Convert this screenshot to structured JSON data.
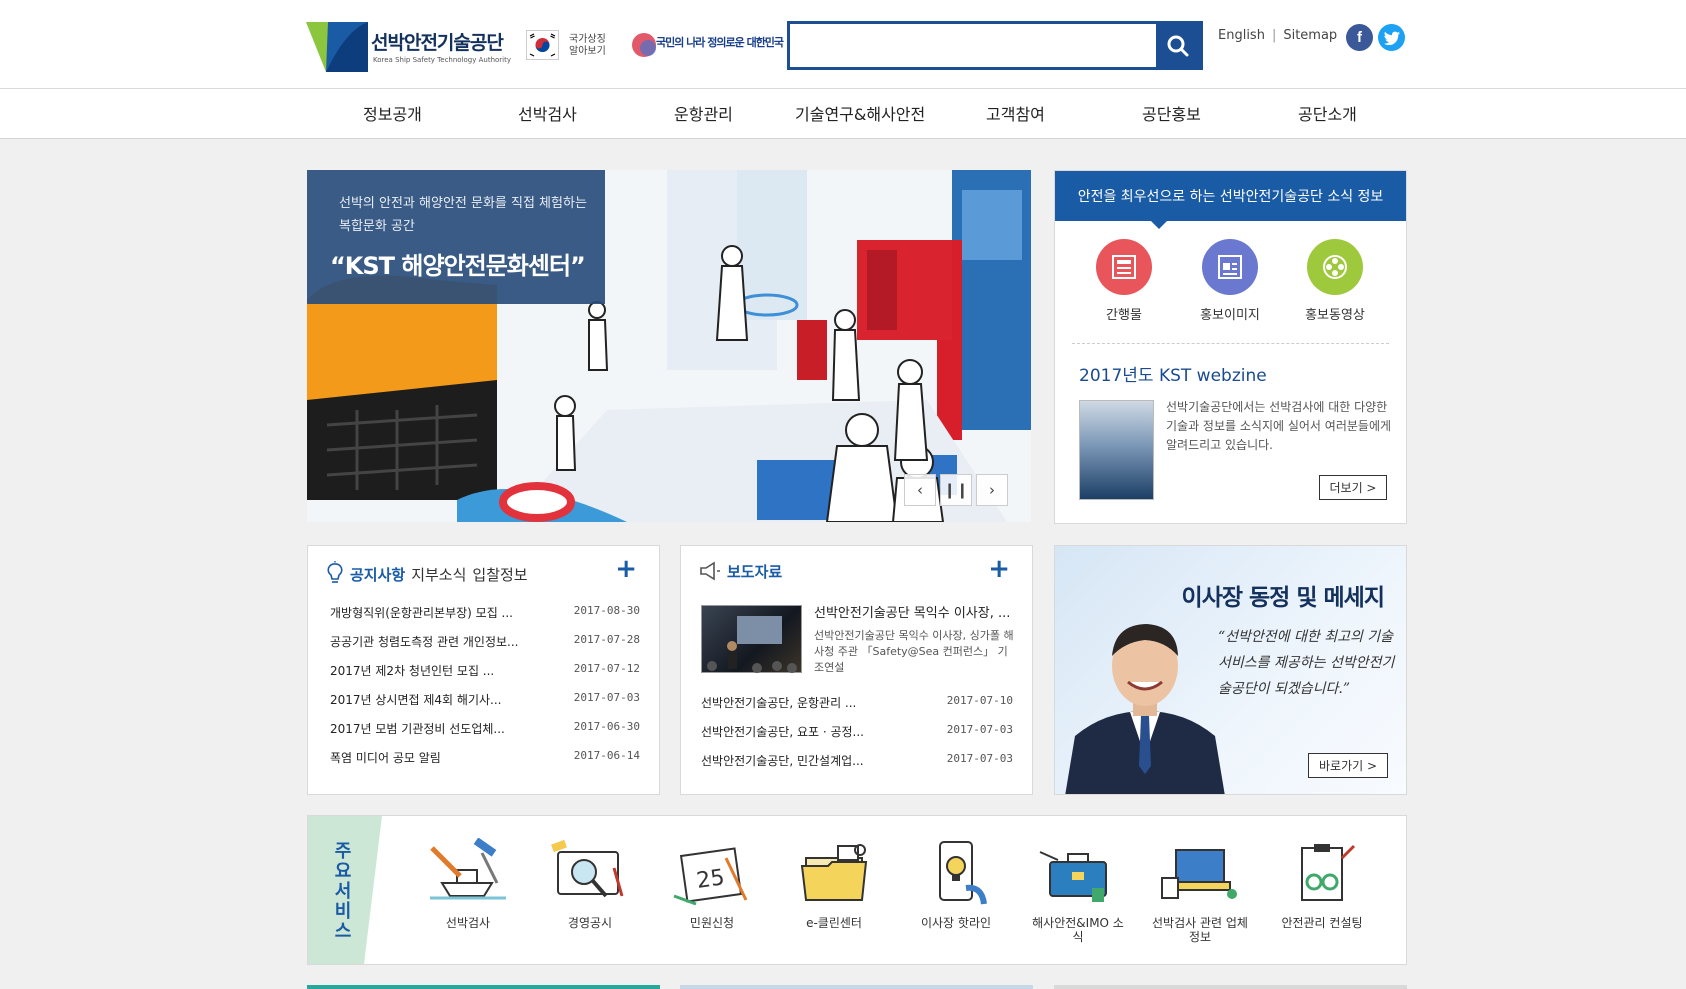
{
  "header": {
    "logo_title": "선박안전기술공단",
    "logo_subtitle": "Korea Ship Safety Technology Authority",
    "national_symbol": "국가상징 알아보기",
    "slogan": "국민의 나라 정의로운 대한민국",
    "search": {
      "value": "",
      "placeholder": ""
    },
    "util_links": [
      "English",
      "Sitemap"
    ],
    "sns_icons": [
      "facebook-icon",
      "twitter-icon"
    ]
  },
  "gnb": [
    "정보공개",
    "선박검사",
    "운항관리",
    "기술연구&해사안전",
    "고객참여",
    "공단홍보",
    "공단소개"
  ],
  "visual": {
    "caption_small": "선박의 안전과 해양안전 문화를 직접 체험하는 복합문화 공간",
    "caption_large": "“KST 해양안전문화센터”",
    "controls": [
      "prev-icon",
      "pause-icon",
      "next-icon"
    ]
  },
  "news_info": {
    "header": "안전을 최우선으로 하는 선박안전기술공단 소식 정보",
    "icons": [
      {
        "label": "간행물",
        "icon": "publication-icon",
        "color": "#e8555a"
      },
      {
        "label": "홍보이미지",
        "icon": "news-image-icon",
        "color": "#6a79cf"
      },
      {
        "label": "홍보동영상",
        "icon": "film-reel-icon",
        "color": "#9fc93c"
      }
    ],
    "webzine_title": "2017년도 KST webzine",
    "webzine_desc": "선박기술공단에서는 선박검사에 대한 다양한 기술과 정보를 소식지에 실어서 여러분들에게 알려드리고 있습니다.",
    "more": "더보기 >"
  },
  "notice": {
    "tabs": [
      "공지사항",
      "지부소식",
      "입찰정보"
    ],
    "items": [
      {
        "title": "개방형직위(운항관리본부장) 모집 ...",
        "date": "2017-08-30"
      },
      {
        "title": "공공기관 청렴도측정 관련 개인정보...",
        "date": "2017-07-28"
      },
      {
        "title": "2017년 제2차 청년인턴 모집 ...",
        "date": "2017-07-12"
      },
      {
        "title": "2017년 상시면접 제4회 해기사...",
        "date": "2017-07-03"
      },
      {
        "title": "2017년 모범 기관정비 선도업체...",
        "date": "2017-06-30"
      },
      {
        "title": "폭염 미디어 공모 알림",
        "date": "2017-06-14"
      }
    ]
  },
  "press": {
    "tab": "보도자료",
    "featured_title": "선박안전기술공단 목익수 이사장, ...",
    "featured_desc": "선박안전기술공단 목익수 이사장, 싱가폴 해사청 주관 「Safety@Sea 컨퍼런스」 기조연설",
    "items": [
      {
        "title": "선박안전기술공단, 운항관리 ...",
        "date": "2017-07-10"
      },
      {
        "title": "선박안전기술공단, 요포 · 공정...",
        "date": "2017-07-03"
      },
      {
        "title": "선박안전기술공단, 민간설계업...",
        "date": "2017-07-03"
      }
    ]
  },
  "ceo": {
    "title": "이사장 동정 및 메세지",
    "message": "“선박안전에 대한 최고의 기술서비스를 제공하는 선박안전기술공단이 되겠습니다.”",
    "more": "바로가기 >"
  },
  "services": {
    "title": "주요서비스",
    "items": [
      {
        "label": "선박검사",
        "icon": "ship-inspection-icon"
      },
      {
        "label": "경영공시",
        "icon": "management-disclosure-icon"
      },
      {
        "label": "민원신청",
        "icon": "calendar-icon"
      },
      {
        "label": "e-클린센터",
        "icon": "folder-icon"
      },
      {
        "label": "이사장 핫라인",
        "icon": "phone-hotline-icon"
      },
      {
        "label": "해사안전&IMO 소식",
        "icon": "briefcase-icon"
      },
      {
        "label": "선박검사 관련 업체정보",
        "icon": "laptop-icon"
      },
      {
        "label": "안전관리 컨설팅",
        "icon": "clipboard-icon"
      }
    ]
  },
  "colors": {
    "primary": "#1a5ba6",
    "accent_green": "#cde7d6",
    "navy": "#13315c"
  }
}
